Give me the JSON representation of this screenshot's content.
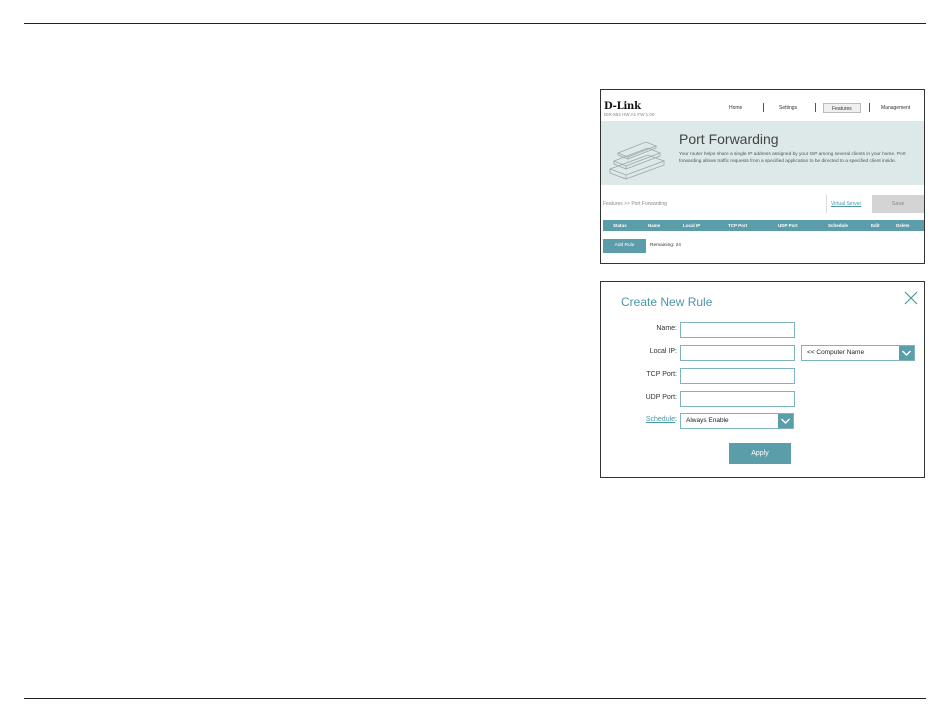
{
  "port_forwarding": {
    "brand": "D-Link",
    "model": "DIR-863 HW:A1 FW:1.00",
    "nav": [
      "Home",
      "Settings",
      "Features",
      "Management"
    ],
    "active_nav": "Features",
    "title": "Port Forwarding",
    "description": "Your router helps share a single IP address assigned by your ISP among several clients in your home. Port forwarding allows traffic requests from a specified application to be directed to a specified client inside.",
    "breadcrumb": "Features >> Port Forwarding",
    "virtual_server_link": "Virtual Server",
    "save_label": "Save",
    "columns": [
      "Status",
      "Name",
      "Local IP",
      "TCP Port",
      "UDP Port",
      "Schedule",
      "Edit",
      "Delete"
    ],
    "add_rule_label": "Add Rule",
    "remaining": "Remaining: 24"
  },
  "create_rule": {
    "title": "Create New Rule",
    "name_label": "Name:",
    "local_ip_label": "Local IP:",
    "tcp_port_label": "TCP Port:",
    "udp_port_label": "UDP Port:",
    "schedule_label": "Schedule",
    "schedule_colon": ":",
    "computer_name_value": "<< Computer Name",
    "schedule_value": "Always Enable",
    "apply_label": "Apply"
  },
  "colors": {
    "accent": "#5b9ea9",
    "link": "#4a97a6",
    "hero_bg": "#dde8e8"
  }
}
